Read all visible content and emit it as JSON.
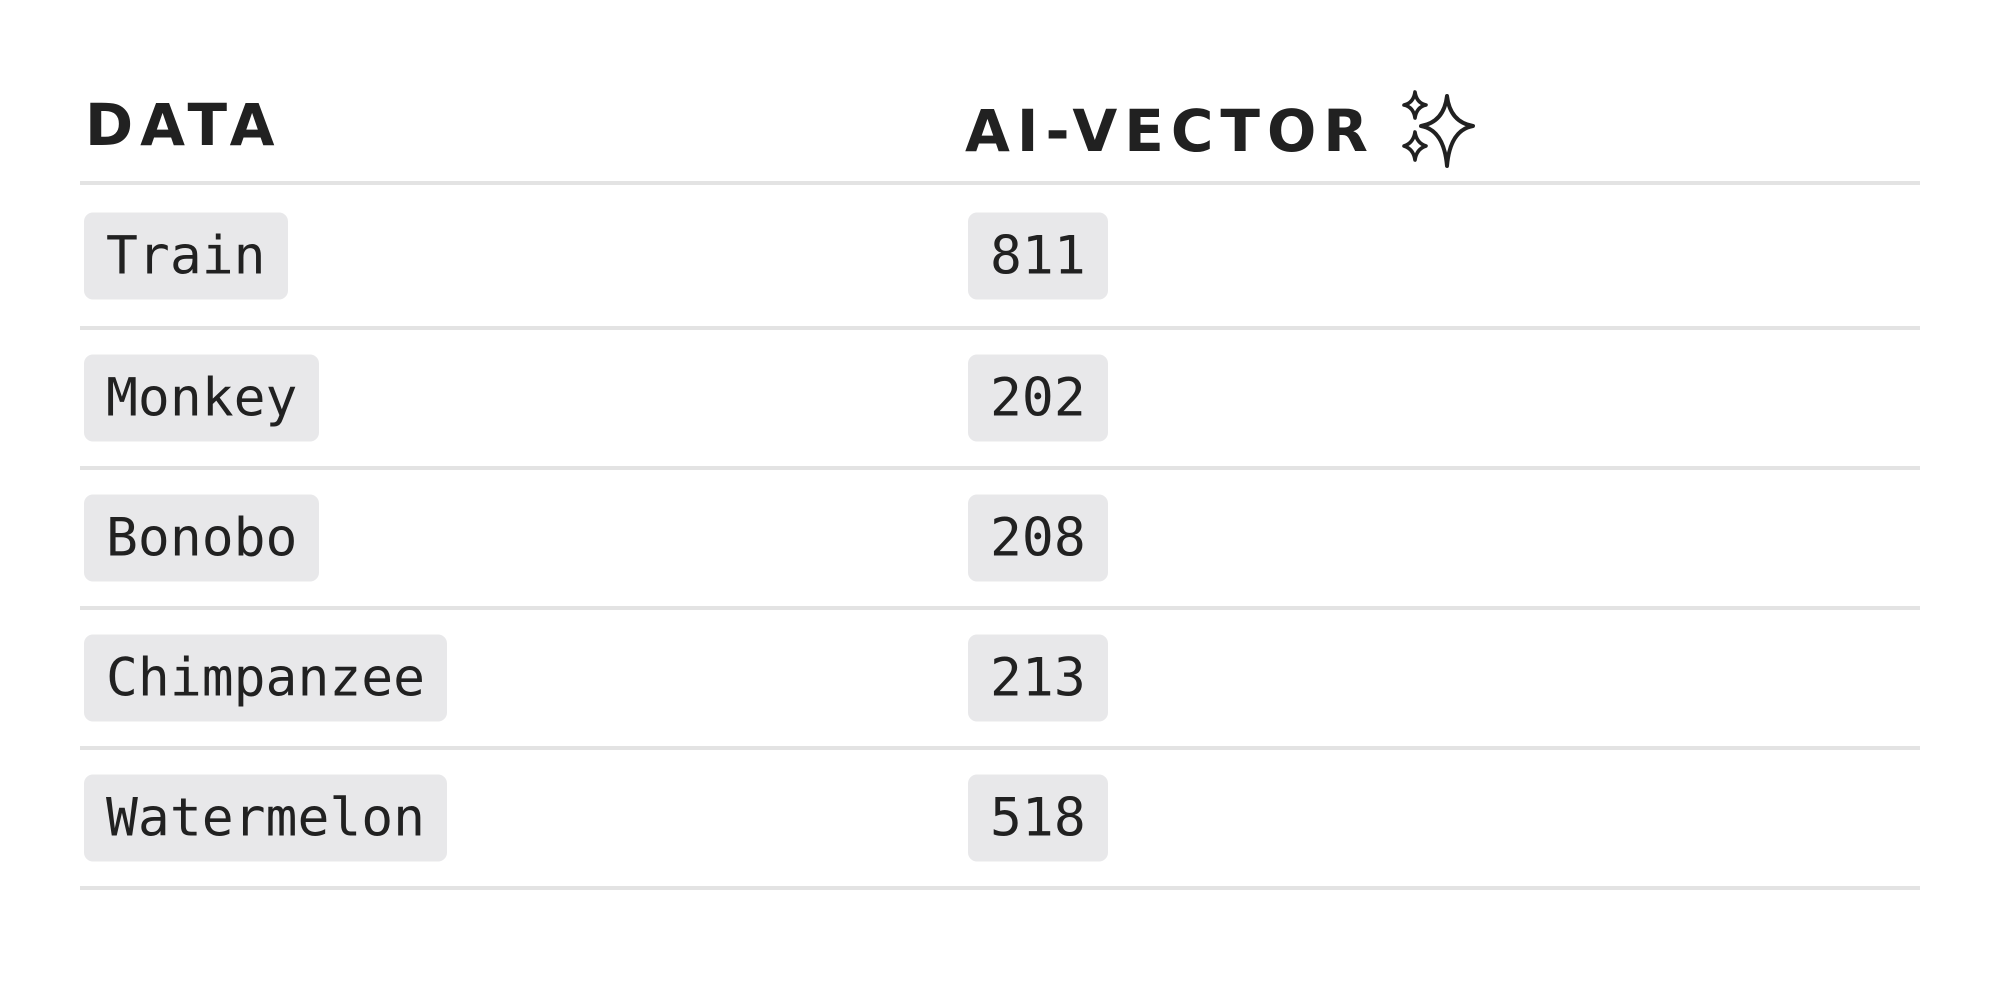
{
  "table": {
    "columns": [
      "DATA",
      "AI-VECTOR"
    ],
    "header_icon": "sparkles-icon",
    "rows": [
      {
        "data": "Train",
        "vector": "811"
      },
      {
        "data": "Monkey",
        "vector": "202"
      },
      {
        "data": "Bonobo",
        "vector": "208"
      },
      {
        "data": "Chimpanzee",
        "vector": "213"
      },
      {
        "data": "Watermelon",
        "vector": "518"
      }
    ]
  },
  "colors": {
    "text": "#212121",
    "chip_background": "#e8e8ea",
    "divider": "#e3e3e3",
    "background": "#ffffff"
  }
}
